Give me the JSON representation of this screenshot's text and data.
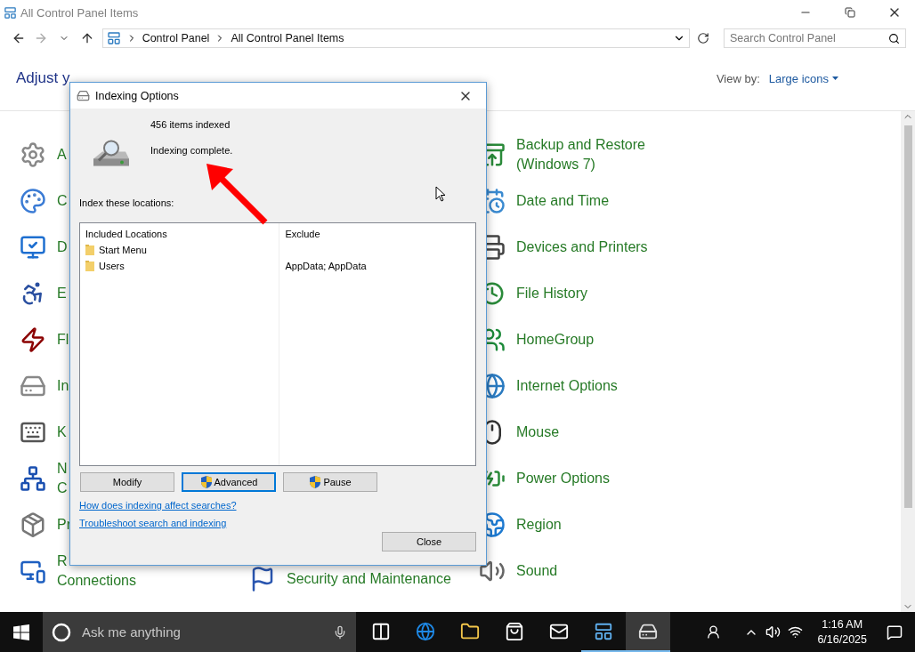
{
  "window": {
    "title": "All Control Panel Items"
  },
  "address": {
    "crumbs": [
      "Control Panel",
      "All Control Panel Items"
    ],
    "search_placeholder": "Search Control Panel"
  },
  "header": {
    "title": "Adjust y",
    "view_by_label": "View by:",
    "view_by_value": "Large icons"
  },
  "columns": [
    {
      "items": [
        {
          "lines": [
            "A"
          ]
        },
        {
          "lines": [
            "C"
          ]
        },
        {
          "lines": [
            "D"
          ]
        },
        {
          "lines": [
            "E"
          ]
        },
        {
          "lines": [
            "Fl"
          ]
        },
        {
          "lines": [
            "In"
          ]
        },
        {
          "lines": [
            "K"
          ]
        },
        {
          "lines": [
            "N",
            "C"
          ]
        },
        {
          "lines": [
            "Pr"
          ]
        },
        {
          "lines": [
            "R",
            "Connections"
          ]
        }
      ]
    },
    {
      "items": [
        {
          "lines": [
            "Security and Maintenance"
          ]
        }
      ]
    },
    {
      "items": [
        {
          "lines": [
            "Backup and Restore",
            "(Windows 7)"
          ]
        },
        {
          "lines": [
            "Date and Time"
          ]
        },
        {
          "lines": [
            "Devices and Printers"
          ]
        },
        {
          "lines": [
            "File History"
          ]
        },
        {
          "lines": [
            "HomeGroup"
          ]
        },
        {
          "lines": [
            "Internet Options"
          ]
        },
        {
          "lines": [
            "Mouse"
          ]
        },
        {
          "lines": [
            "Power Options"
          ]
        },
        {
          "lines": [
            "Region"
          ]
        },
        {
          "lines": [
            "Sound"
          ]
        }
      ]
    }
  ],
  "dialog": {
    "title": "Indexing Options",
    "count": "456 items indexed",
    "status": "Indexing complete.",
    "locations_label": "Index these locations:",
    "table": {
      "columns": [
        "Included Locations",
        "Exclude"
      ],
      "rows": [
        {
          "location": "Start Menu"
        },
        {
          "location": "Users",
          "exclude": "AppData; AppData"
        }
      ]
    },
    "buttons": [
      {
        "label": "Modify",
        "shield": false,
        "focused": false
      },
      {
        "label": "Advanced",
        "shield": true,
        "focused": true
      },
      {
        "label": "Pause",
        "shield": true,
        "focused": false
      }
    ],
    "links": [
      "How does indexing affect searches?",
      "Troubleshoot search and indexing"
    ],
    "close_button": "Close"
  },
  "taskbar": {
    "search_placeholder": "Ask me anything",
    "apps": [
      {
        "running": false,
        "active": false
      },
      {
        "running": false,
        "active": false
      },
      {
        "running": false,
        "active": false
      },
      {
        "running": false,
        "active": false
      },
      {
        "running": false,
        "active": false
      },
      {
        "running": true,
        "active": false
      },
      {
        "running": true,
        "active": true
      }
    ],
    "time": "1:16 AM",
    "date": "6/16/2025"
  }
}
